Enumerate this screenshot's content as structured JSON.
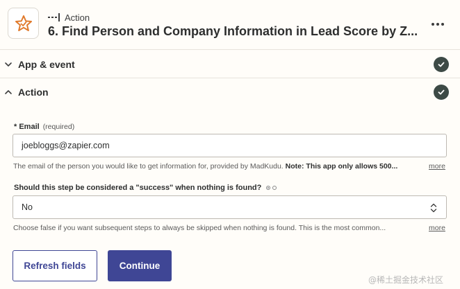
{
  "header": {
    "step_type": "Action",
    "title": "6. Find Person and Company Information in Lead Score by Z..."
  },
  "sections": [
    {
      "label": "App & event",
      "complete": true
    },
    {
      "label": "Action",
      "complete": true
    }
  ],
  "fields": {
    "email": {
      "label": "* Email",
      "required_text": "(required)",
      "value": "joebloggs@zapier.com",
      "help_text": "The email of the person you would like to get information for, provided by MadKudu.",
      "help_note": "Note: This app only allows 500...",
      "more_label": "more"
    },
    "success": {
      "label": "Should this step be considered a \"success\" when nothing is found?",
      "value": "No",
      "help_text": "Choose false if you want subsequent steps to always be skipped when nothing is found. This is the most common...",
      "more_label": "more"
    }
  },
  "buttons": {
    "refresh": "Refresh fields",
    "continue": "Continue"
  },
  "watermark": "@稀土掘金技术社区",
  "colors": {
    "brand_orange": "#e07a2c",
    "primary_button": "#3f4695",
    "check_badge": "#3d4a46"
  }
}
